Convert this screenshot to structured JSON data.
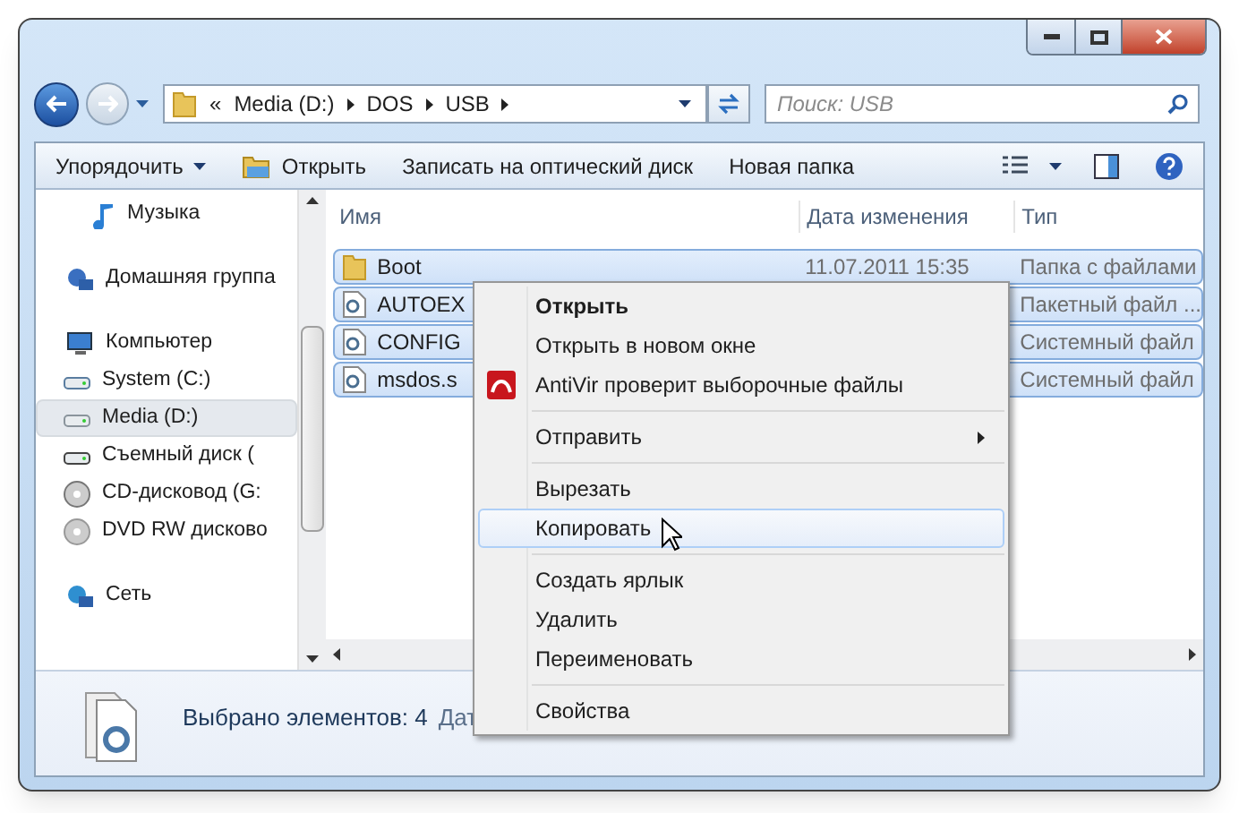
{
  "address": {
    "overflow": "«",
    "parts": [
      "Media (D:)",
      "DOS",
      "USB"
    ]
  },
  "search": {
    "placeholder": "Поиск: USB"
  },
  "toolbar": [
    {
      "label": "Упорядочить",
      "kind": "menu"
    },
    {
      "label": "Открыть",
      "kind": "open"
    },
    {
      "label": "Записать на оптический диск",
      "kind": "plain"
    },
    {
      "label": "Новая папка",
      "kind": "plain"
    }
  ],
  "sidebar": [
    {
      "label": "Музыка",
      "kind": "music",
      "selected": false
    },
    {
      "label": "Домашняя группа",
      "kind": "homegroup",
      "selected": false
    },
    {
      "label": "Компьютер",
      "kind": "computer",
      "selected": false,
      "children": [
        {
          "label": "System (C:)",
          "kind": "system",
          "selected": false
        },
        {
          "label": "Media (D:)",
          "kind": "drive",
          "selected": true
        },
        {
          "label": "Съемный диск (",
          "kind": "removable",
          "selected": false
        },
        {
          "label": "CD-дисковод (G:",
          "kind": "cd",
          "selected": false
        },
        {
          "label": "DVD RW дисково",
          "kind": "dvd",
          "selected": false
        }
      ]
    },
    {
      "label": "Сеть",
      "kind": "network",
      "selected": false
    }
  ],
  "table": {
    "columns": [
      "Имя",
      "Дата изменения",
      "Тип"
    ],
    "rows": [
      {
        "name": "Boot",
        "kind": "folder",
        "date": "11.07.2011 15:35",
        "type": "Папка с файлами",
        "selected": true
      },
      {
        "name": "AUTOEX",
        "kind": "batch",
        "date": "",
        "type": "Пакетный файл ...",
        "selected": true
      },
      {
        "name": "CONFIG",
        "kind": "system",
        "date": "",
        "type": "Системный файл",
        "selected": true
      },
      {
        "name": "msdos.s",
        "kind": "system",
        "date": "",
        "type": "Системный файл",
        "selected": true
      }
    ]
  },
  "context_menu": [
    [
      {
        "label": "Открыть",
        "kind": "default",
        "highlighted": false
      },
      {
        "label": "Открыть в новом окне",
        "kind": "plain",
        "highlighted": false
      },
      {
        "label": "AntiVir проверит выборочные файлы",
        "kind": "antivir",
        "highlighted": false
      }
    ],
    [
      {
        "label": "Отправить",
        "kind": "submenu",
        "highlighted": false
      }
    ],
    [
      {
        "label": "Вырезать",
        "kind": "plain",
        "highlighted": false
      },
      {
        "label": "Копировать",
        "kind": "plain",
        "highlighted": true
      }
    ],
    [
      {
        "label": "Создать ярлык",
        "kind": "plain",
        "highlighted": false
      },
      {
        "label": "Удалить",
        "kind": "plain",
        "highlighted": false
      },
      {
        "label": "Переименовать",
        "kind": "plain",
        "highlighted": false
      }
    ],
    [
      {
        "label": "Свойства",
        "kind": "plain",
        "highlighted": false
      }
    ]
  ],
  "status_bar": {
    "text": "Выбрано элементов: 4",
    "extra": "Дат"
  }
}
